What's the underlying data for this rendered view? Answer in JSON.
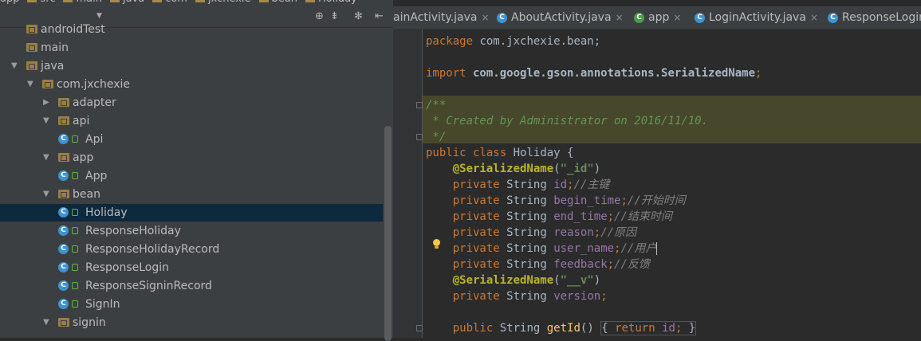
{
  "breadcrumb": [
    "app",
    "src",
    "main",
    "java",
    "com",
    "jxchexie",
    "bean",
    "Holiday"
  ],
  "project_tree": [
    {
      "label": "androidTest",
      "depth": 0,
      "kind": "folder",
      "arrow": ""
    },
    {
      "label": "main",
      "depth": 0,
      "kind": "folder",
      "arrow": ""
    },
    {
      "label": "java",
      "depth": 0,
      "kind": "folder",
      "arrow": "▼"
    },
    {
      "label": "com.jxchexie",
      "depth": 1,
      "kind": "folder",
      "arrow": "▼"
    },
    {
      "label": "adapter",
      "depth": 2,
      "kind": "folder",
      "arrow": "▶"
    },
    {
      "label": "api",
      "depth": 2,
      "kind": "folder",
      "arrow": "▼"
    },
    {
      "label": "Api",
      "depth": 3,
      "kind": "class",
      "arrow": ""
    },
    {
      "label": "app",
      "depth": 2,
      "kind": "folder",
      "arrow": "▼"
    },
    {
      "label": "App",
      "depth": 3,
      "kind": "class",
      "arrow": ""
    },
    {
      "label": "bean",
      "depth": 2,
      "kind": "folder",
      "arrow": "▼"
    },
    {
      "label": "Holiday",
      "depth": 3,
      "kind": "class",
      "arrow": "",
      "selected": true
    },
    {
      "label": "ResponseHoliday",
      "depth": 3,
      "kind": "class",
      "arrow": ""
    },
    {
      "label": "ResponseHolidayRecord",
      "depth": 3,
      "kind": "class",
      "arrow": ""
    },
    {
      "label": "ResponseLogin",
      "depth": 3,
      "kind": "class",
      "arrow": ""
    },
    {
      "label": "ResponseSigninRecord",
      "depth": 3,
      "kind": "class",
      "arrow": ""
    },
    {
      "label": "SignIn",
      "depth": 3,
      "kind": "class",
      "arrow": ""
    },
    {
      "label": "signin",
      "depth": 2,
      "kind": "folder",
      "arrow": "▼"
    }
  ],
  "toolbar_icons": [
    "target-icon",
    "collapse-icon",
    "gear-icon",
    "hide-icon"
  ],
  "tabs": [
    {
      "label": "ainActivity.java",
      "icon": "",
      "close": "×"
    },
    {
      "label": "AboutActivity.java",
      "icon": "C",
      "close": "×"
    },
    {
      "label": "app",
      "icon": "C",
      "close": "×"
    },
    {
      "label": "LoginActivity.java",
      "icon": "C",
      "close": "×"
    },
    {
      "label": "ResponseLogin",
      "icon": "C",
      "close": ""
    }
  ],
  "code": {
    "package_kw": "package",
    "package_name": " com.jxchexie.bean;",
    "import_kw": "import",
    "import_name": " com.google.gson.annotations.SerializedName",
    "semicolon": ";",
    "doc1": "/**",
    "doc2": " * Created by Administrator on 2016/11/10.",
    "doc3": " */",
    "public": "public",
    "class": "class",
    "class_name": " Holiday {",
    "ann": "@SerializedName",
    "id_key": "\"_id\"",
    "v_key": "\"__v\"",
    "private": "private",
    "type": "String",
    "fields": [
      {
        "name": "id",
        "comment": "//主键"
      },
      {
        "name": "begin_time",
        "comment": "//开始时间"
      },
      {
        "name": "end_time",
        "comment": "//结束时间"
      },
      {
        "name": "reason",
        "comment": "//原因"
      },
      {
        "name": "user_name",
        "comment": "//用户"
      },
      {
        "name": "feedback",
        "comment": "//反馈"
      }
    ],
    "version": "version",
    "getter_public": "public",
    "getter_type": "String",
    "getter_name": "getId",
    "return_kw": "return",
    "return_val": "id"
  },
  "colors": {
    "keyword": "#cc7832",
    "annotation": "#bbb529",
    "string": "#6a8759",
    "field": "#9876aa",
    "comment": "#808080",
    "method": "#ffc66d"
  }
}
